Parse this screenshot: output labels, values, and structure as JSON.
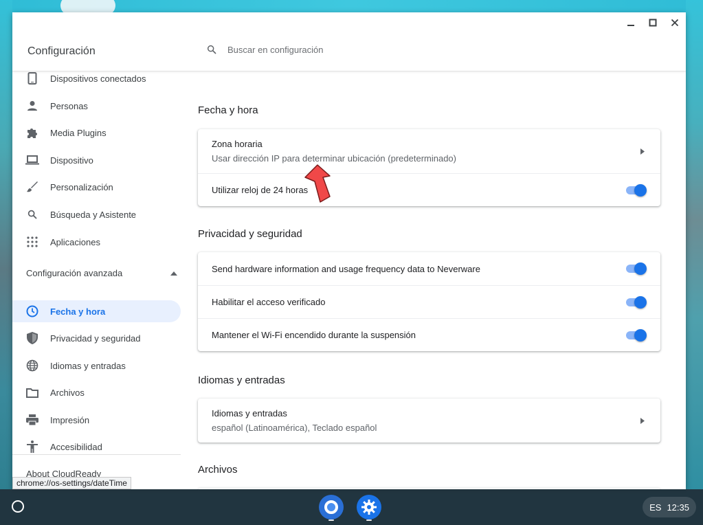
{
  "window": {
    "minimize": "—",
    "maximize": "☐",
    "close": "✕"
  },
  "header": {
    "title": "Configuración",
    "search_placeholder": "Buscar en configuración"
  },
  "sidebar": {
    "items": [
      {
        "label": "Dispositivos conectados",
        "icon": "phone-icon"
      },
      {
        "label": "Personas",
        "icon": "person-icon"
      },
      {
        "label": "Media Plugins",
        "icon": "puzzle-icon"
      },
      {
        "label": "Dispositivo",
        "icon": "laptop-icon"
      },
      {
        "label": "Personalización",
        "icon": "brush-icon"
      },
      {
        "label": "Búsqueda y Asistente",
        "icon": "search-icon"
      },
      {
        "label": "Aplicaciones",
        "icon": "apps-grid-icon"
      }
    ],
    "advanced_label": "Configuración avanzada",
    "advanced_items": [
      {
        "label": "Fecha y hora",
        "icon": "clock-icon",
        "active": true
      },
      {
        "label": "Privacidad y seguridad",
        "icon": "shield-icon"
      },
      {
        "label": "Idiomas y entradas",
        "icon": "globe-icon"
      },
      {
        "label": "Archivos",
        "icon": "folder-icon"
      },
      {
        "label": "Impresión",
        "icon": "printer-icon"
      },
      {
        "label": "Accesibilidad",
        "icon": "accessibility-icon"
      }
    ],
    "about": "About CloudReady"
  },
  "main": {
    "datetime": {
      "title": "Fecha y hora",
      "timezone_title": "Zona horaria",
      "timezone_sub": "Usar dirección IP para determinar ubicación (predeterminado)",
      "clock24_label": "Utilizar reloj de 24 horas",
      "clock24_on": true
    },
    "privacy": {
      "title": "Privacidad y seguridad",
      "rows": [
        {
          "label": "Send hardware information and usage frequency data to Neverware",
          "on": true
        },
        {
          "label": "Habilitar el acceso verificado",
          "on": true
        },
        {
          "label": "Mantener el Wi-Fi encendido durante la suspensión",
          "on": true
        }
      ]
    },
    "languages": {
      "title": "Idiomas y entradas",
      "row_title": "Idiomas y entradas",
      "row_sub": "español (Latinoamérica), Teclado español"
    },
    "files": {
      "title": "Archivos"
    }
  },
  "status_url": "chrome://os-settings/dateTime",
  "shelf": {
    "ime": "ES",
    "time": "12:35"
  },
  "colors": {
    "accent": "#1a73e8",
    "active_bg": "#e8f0fe",
    "toggle_track": "#8ab4f8",
    "annotation_arrow": "#f04848"
  }
}
